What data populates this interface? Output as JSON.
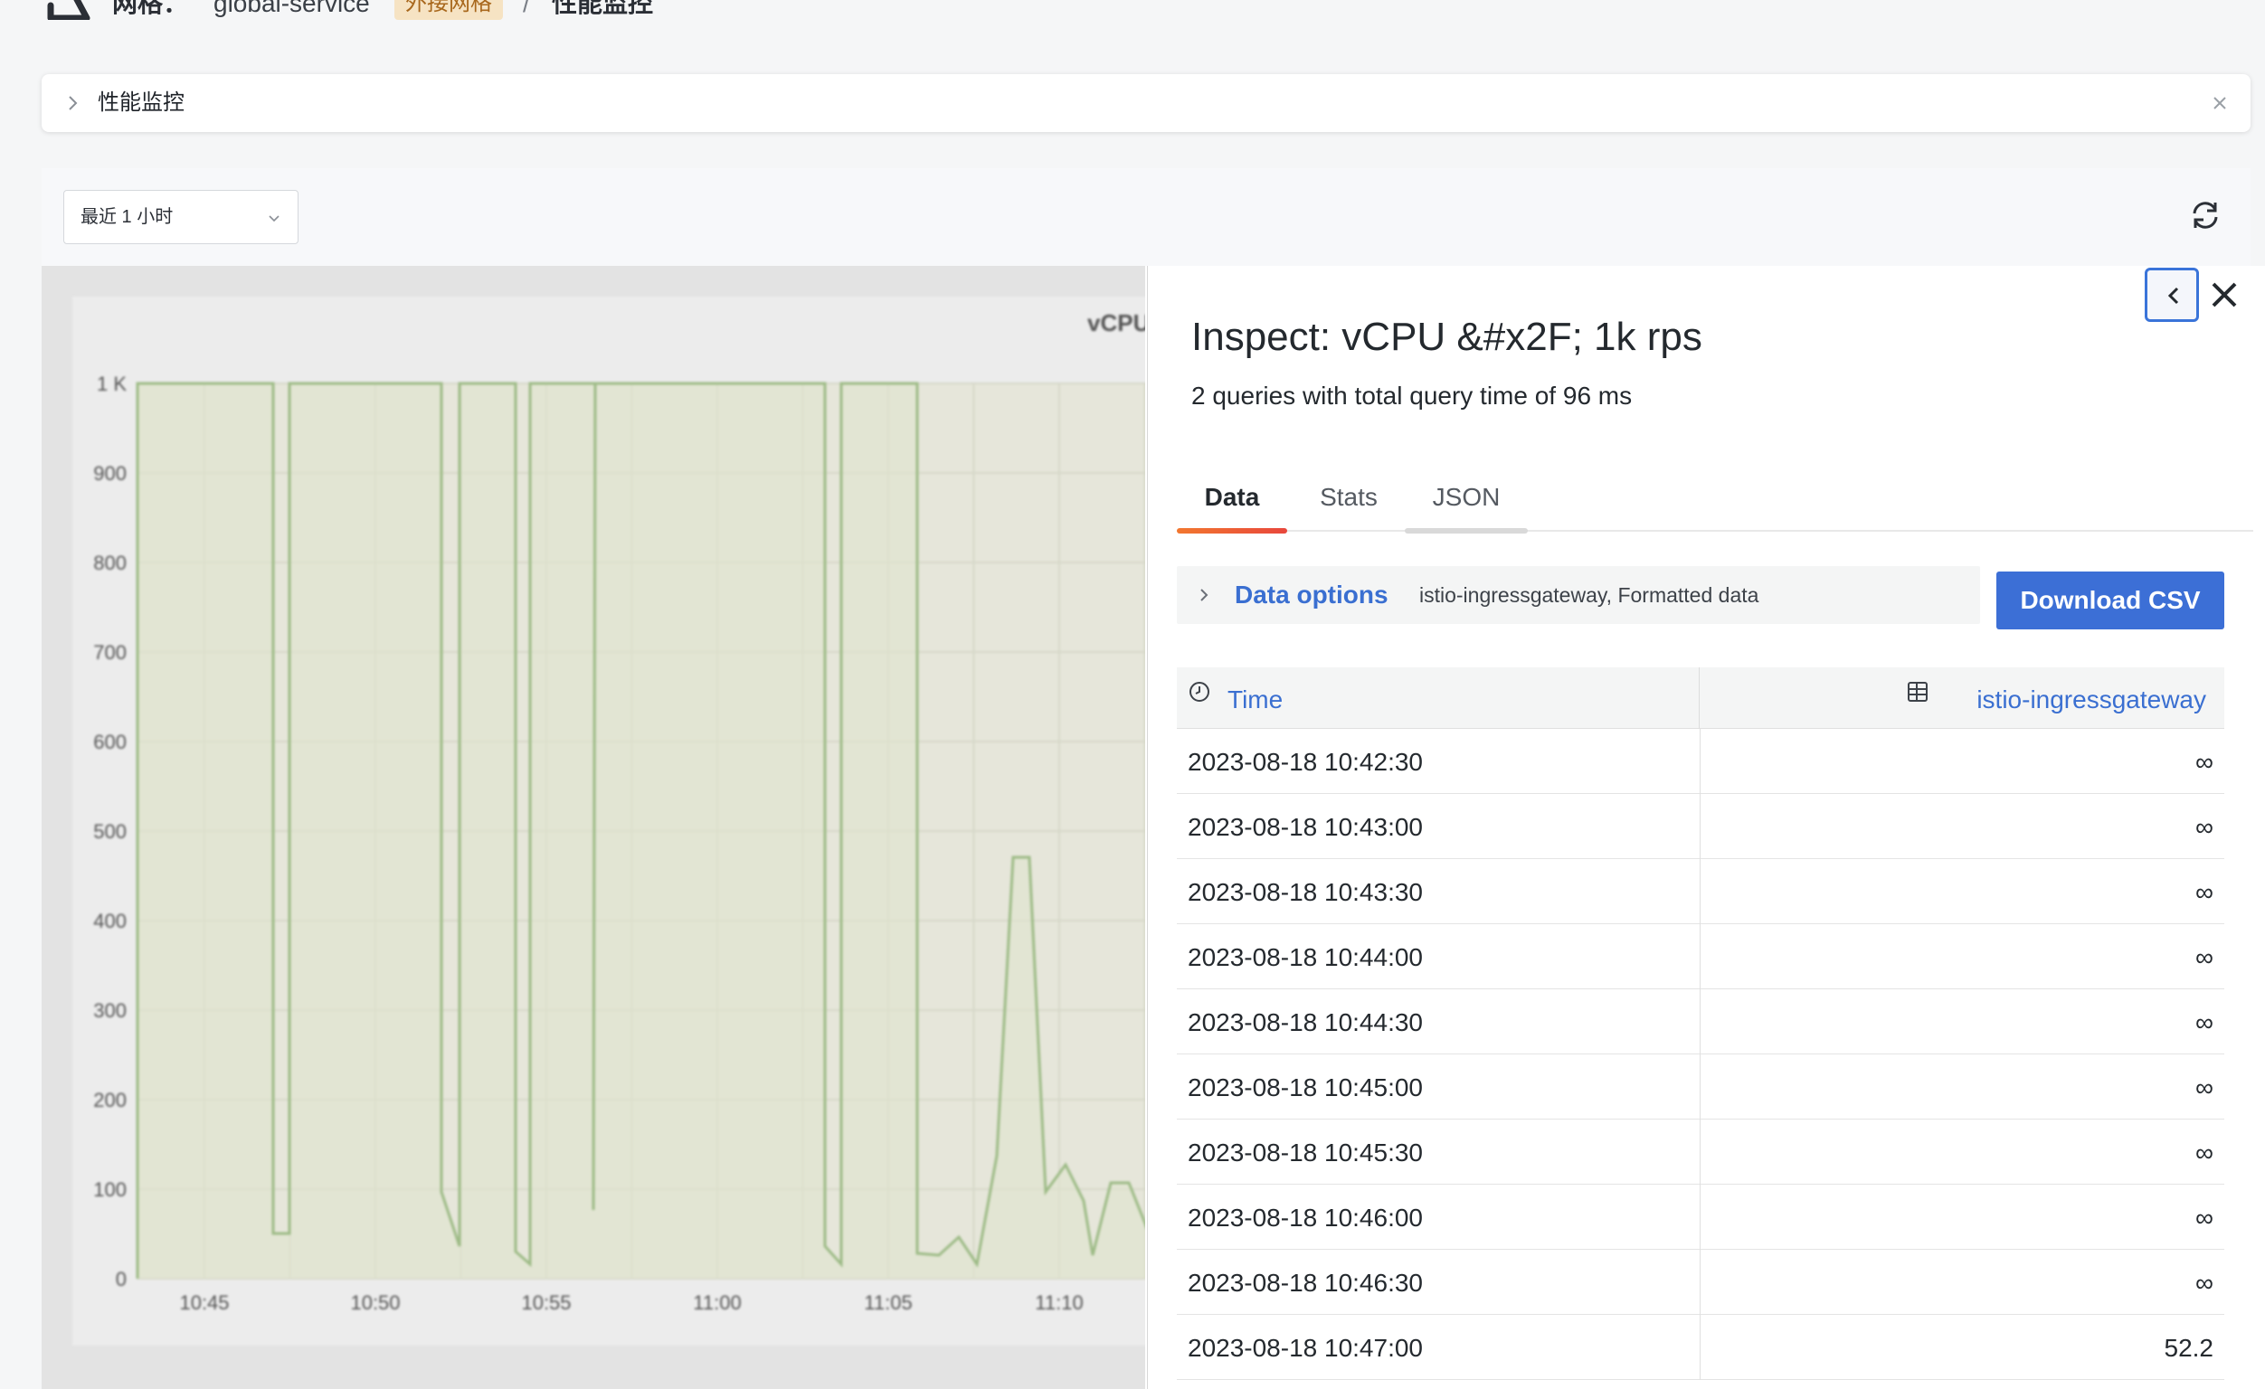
{
  "breadcrumb": {
    "mesh_label": "网格：",
    "mesh_name": "global-service",
    "mesh_badge": "外接网格",
    "separator": "/",
    "current": "性能监控"
  },
  "collapse_bar": {
    "title": "性能监控"
  },
  "toolbar": {
    "time_range": "最近 1 小时"
  },
  "chart": {
    "title": "vCPU /",
    "y_ticks": [
      "1 K",
      "900",
      "800",
      "700",
      "600",
      "500",
      "400",
      "300",
      "200",
      "100",
      "0"
    ],
    "x_ticks": [
      "10:45",
      "10:50",
      "10:55",
      "11:00",
      "11:05",
      "11:10"
    ]
  },
  "inspect": {
    "title": "Inspect: vCPU &#x2F; 1k rps",
    "subtitle": "2 queries with total query time of 96 ms",
    "tabs": {
      "data": "Data",
      "stats": "Stats",
      "json": "JSON"
    },
    "data_options_label": "Data options",
    "data_options_desc": "istio-ingressgateway, Formatted data",
    "download_button": "Download CSV",
    "table": {
      "col_time": "Time",
      "col_series": "istio-ingressgateway",
      "rows": [
        {
          "time": "2023-08-18 10:42:30",
          "value": "∞"
        },
        {
          "time": "2023-08-18 10:43:00",
          "value": "∞"
        },
        {
          "time": "2023-08-18 10:43:30",
          "value": "∞"
        },
        {
          "time": "2023-08-18 10:44:00",
          "value": "∞"
        },
        {
          "time": "2023-08-18 10:44:30",
          "value": "∞"
        },
        {
          "time": "2023-08-18 10:45:00",
          "value": "∞"
        },
        {
          "time": "2023-08-18 10:45:30",
          "value": "∞"
        },
        {
          "time": "2023-08-18 10:46:00",
          "value": "∞"
        },
        {
          "time": "2023-08-18 10:46:30",
          "value": "∞"
        },
        {
          "time": "2023-08-18 10:47:00",
          "value": "52.2"
        }
      ]
    }
  },
  "colors": {
    "accent_blue": "#3c6fd6",
    "tab_underline": "#e8473c",
    "badge_bg": "#f6e3c3",
    "series_green": "#8fb67a"
  }
}
